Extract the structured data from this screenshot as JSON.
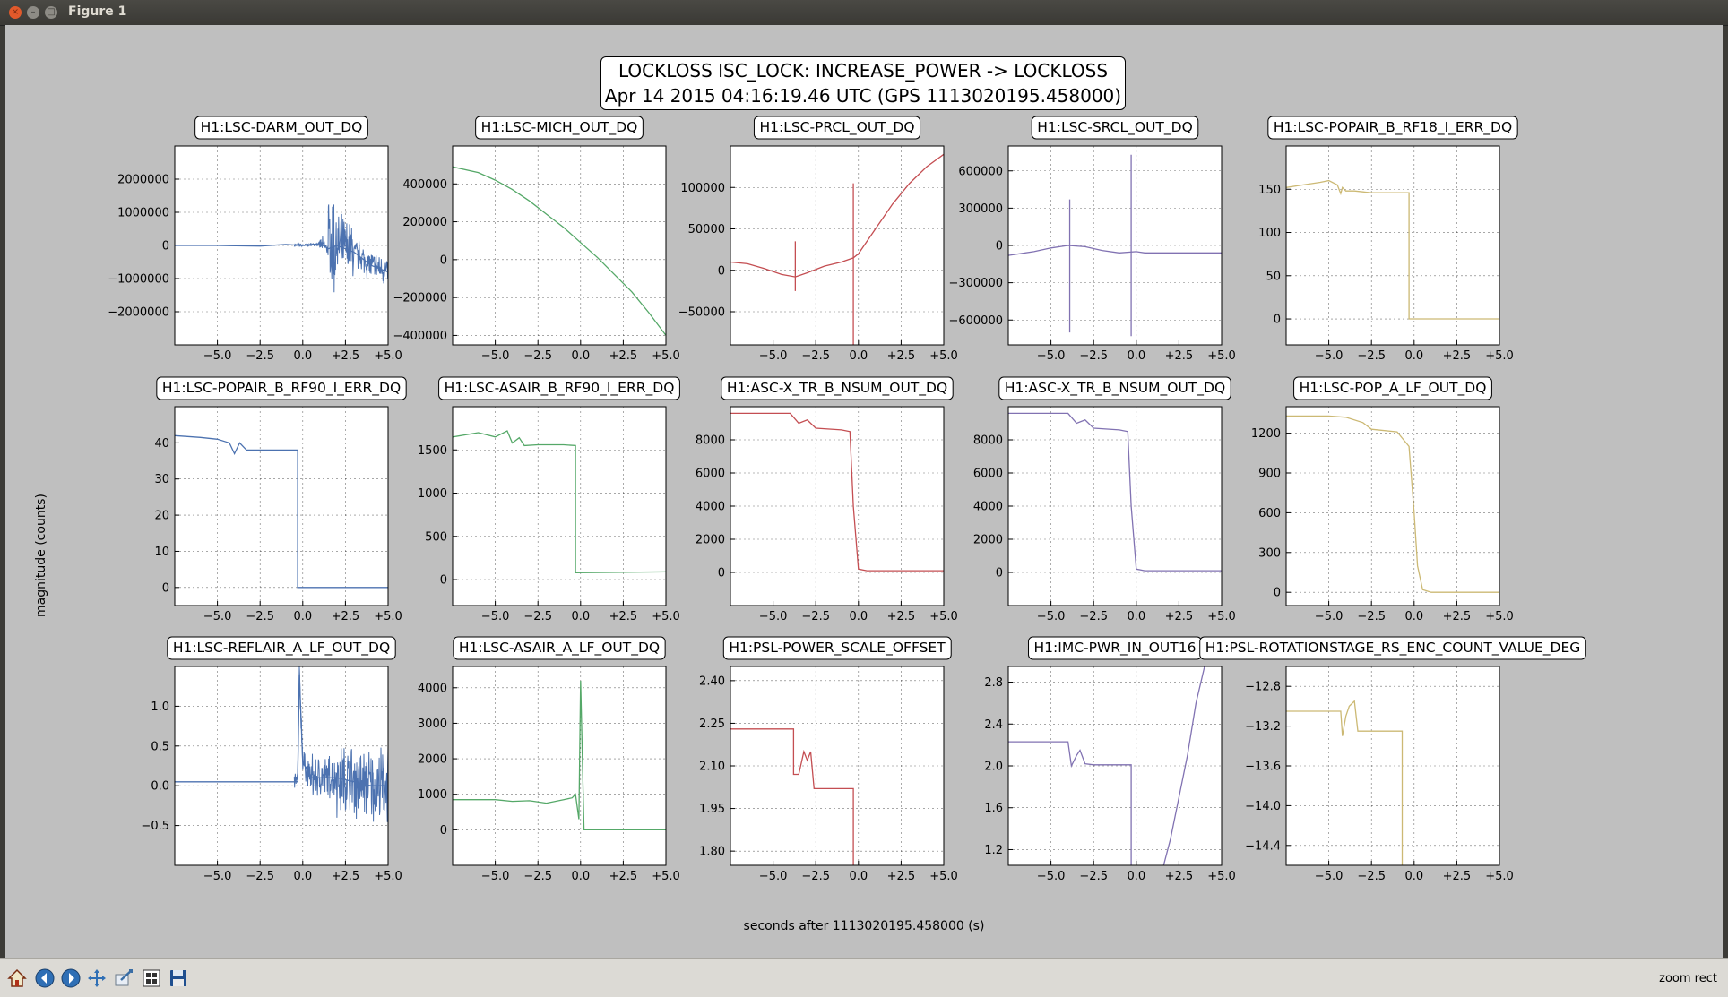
{
  "window": {
    "title": "Figure 1"
  },
  "figure": {
    "suptitle_line1": "LOCKLOSS ISC_LOCK: INCREASE_POWER -> LOCKLOSS",
    "suptitle_line2": "Apr 14 2015 04:16:19.46 UTC (GPS 1113020195.458000)",
    "ylabel": "magnitude (counts)",
    "xlabel": "seconds after 1113020195.458000 (s)"
  },
  "chart_data": [
    {
      "type": "line",
      "title": "H1:LSC-DARM_OUT_DQ",
      "color": "#4c72b0",
      "xlim": [
        -7.5,
        5
      ],
      "ylim": [
        -3000000,
        3000000
      ],
      "xticks": [
        -5,
        -2.5,
        0,
        2.5,
        5
      ],
      "xticklabels": [
        "−5.0",
        "−2.5",
        "0.0",
        "+2.5",
        "+5.0"
      ],
      "yticks": [
        -2000000,
        -1000000,
        0,
        1000000,
        2000000
      ],
      "yticklabels": [
        "−2000000",
        "−1000000",
        "0",
        "1000000",
        "2000000"
      ],
      "noise": [
        [
          1,
          40000
        ],
        [
          1.5,
          200000
        ],
        [
          2,
          1500000
        ],
        [
          3,
          800000
        ],
        [
          5,
          400000
        ]
      ],
      "series": [
        {
          "x": [
            -7.5,
            -5,
            -2.5,
            -1,
            0,
            1,
            1.5,
            2,
            3,
            4,
            5
          ],
          "y": [
            0,
            0,
            -20000,
            30000,
            0,
            50000,
            -100000,
            0,
            -200000,
            -600000,
            -800000
          ]
        }
      ]
    },
    {
      "type": "line",
      "title": "H1:LSC-MICH_OUT_DQ",
      "color": "#55a868",
      "xlim": [
        -7.5,
        5
      ],
      "ylim": [
        -450000,
        600000
      ],
      "xticks": [
        -5,
        -2.5,
        0,
        2.5,
        5
      ],
      "xticklabels": [
        "−5.0",
        "−2.5",
        "0.0",
        "+2.5",
        "+5.0"
      ],
      "yticks": [
        -400000,
        -200000,
        0,
        200000,
        400000
      ],
      "yticklabels": [
        "−400000",
        "−200000",
        "0",
        "200000",
        "400000"
      ],
      "series": [
        {
          "x": [
            -7.5,
            -6,
            -5,
            -4,
            -3,
            -2,
            -1,
            0,
            1,
            2,
            3,
            4,
            5
          ],
          "y": [
            490000,
            460000,
            420000,
            370000,
            310000,
            240000,
            170000,
            90000,
            10000,
            -80000,
            -170000,
            -280000,
            -400000
          ]
        }
      ]
    },
    {
      "type": "line",
      "title": "H1:LSC-PRCL_OUT_DQ",
      "color": "#c44e52",
      "xlim": [
        -7.5,
        5
      ],
      "ylim": [
        -90000,
        150000
      ],
      "xticks": [
        -5,
        -2.5,
        0,
        2.5,
        5
      ],
      "xticklabels": [
        "−5.0",
        "−2.5",
        "0.0",
        "+2.5",
        "+5.0"
      ],
      "yticks": [
        -50000,
        0,
        50000,
        100000
      ],
      "yticklabels": [
        "−50000",
        "0",
        "50000",
        "100000"
      ],
      "series": [
        {
          "x": [
            -7.5,
            -6.5,
            -5.5,
            -4.5,
            -3.7,
            -3,
            -2,
            -1,
            -0.3,
            0,
            1,
            2,
            3,
            4,
            5
          ],
          "y": [
            10000,
            8000,
            2000,
            -5000,
            -8000,
            -3000,
            5000,
            10000,
            15000,
            20000,
            50000,
            80000,
            105000,
            125000,
            140000
          ]
        }
      ],
      "spikes": [
        [
          -3.7,
          -25000,
          35000
        ],
        [
          -0.3,
          -90000,
          105000
        ]
      ]
    },
    {
      "type": "line",
      "title": "H1:LSC-SRCL_OUT_DQ",
      "color": "#8172b2",
      "xlim": [
        -7.5,
        5
      ],
      "ylim": [
        -800000,
        800000
      ],
      "xticks": [
        -5,
        -2.5,
        0,
        2.5,
        5
      ],
      "xticklabels": [
        "−5.0",
        "−2.5",
        "0.0",
        "+2.5",
        "+5.0"
      ],
      "yticks": [
        -600000,
        -300000,
        0,
        300000,
        600000
      ],
      "yticklabels": [
        "−600000",
        "−300000",
        "0",
        "300000",
        "600000"
      ],
      "series": [
        {
          "x": [
            -7.5,
            -6,
            -5,
            -4,
            -3,
            -2,
            -1,
            0,
            0.5,
            1,
            5
          ],
          "y": [
            -80000,
            -50000,
            -20000,
            0,
            -10000,
            -40000,
            -60000,
            -50000,
            -60000,
            -60000,
            -60000
          ]
        }
      ],
      "spikes": [
        [
          -3.9,
          -700000,
          370000
        ],
        [
          -0.3,
          -730000,
          730000
        ]
      ]
    },
    {
      "type": "line",
      "title": "H1:LSC-POPAIR_B_RF18_I_ERR_DQ",
      "color": "#ccb974",
      "xlim": [
        -7.5,
        5
      ],
      "ylim": [
        -30000,
        200000
      ],
      "yunit": 0.001,
      "xticks": [
        -5,
        -2.5,
        0,
        2.5,
        5
      ],
      "xticklabels": [
        "−5.0",
        "−2.5",
        "0.0",
        "+2.5",
        "+5.0"
      ],
      "yticks": [
        0,
        50000,
        100000,
        150000
      ],
      "yticklabels": [
        "0",
        "50",
        "100",
        "150"
      ],
      "series": [
        {
          "x": [
            -7.5,
            -6.5,
            -5.5,
            -5,
            -4.5,
            -4.3,
            -4.2,
            -4,
            -3.5,
            -3,
            -2.5,
            -1,
            -0.5,
            -0.3,
            -0.3,
            5
          ],
          "y": [
            152000,
            155000,
            158000,
            160000,
            155000,
            145000,
            152000,
            148000,
            148000,
            147000,
            146000,
            146000,
            146000,
            146000,
            0,
            0
          ]
        }
      ]
    },
    {
      "type": "line",
      "title": "H1:LSC-POPAIR_B_RF90_I_ERR_DQ",
      "color": "#4c72b0",
      "xlim": [
        -7.5,
        5
      ],
      "ylim": [
        -5,
        50
      ],
      "xticks": [
        -5,
        -2.5,
        0,
        2.5,
        5
      ],
      "xticklabels": [
        "−5.0",
        "−2.5",
        "0.0",
        "+2.5",
        "+5.0"
      ],
      "yticks": [
        0,
        10,
        20,
        30,
        40
      ],
      "yticklabels": [
        "0",
        "10",
        "20",
        "30",
        "40"
      ],
      "series": [
        {
          "x": [
            -7.5,
            -6,
            -5,
            -4.3,
            -4,
            -3.7,
            -3.3,
            -2.5,
            -1,
            -0.3,
            -0.3,
            5
          ],
          "y": [
            42,
            41.5,
            41,
            40,
            37,
            40,
            38,
            38,
            38,
            38,
            0,
            0
          ]
        }
      ]
    },
    {
      "type": "line",
      "title": "H1:LSC-ASAIR_B_RF90_I_ERR_DQ",
      "color": "#55a868",
      "xlim": [
        -7.5,
        5
      ],
      "ylim": [
        -300,
        2000
      ],
      "xticks": [
        -5,
        -2.5,
        0,
        2.5,
        5
      ],
      "xticklabels": [
        "−5.0",
        "−2.5",
        "0.0",
        "+2.5",
        "+5.0"
      ],
      "yticks": [
        0,
        500,
        1000,
        1500
      ],
      "yticklabels": [
        "0",
        "500",
        "1000",
        "1500"
      ],
      "series": [
        {
          "x": [
            -7.5,
            -6,
            -5,
            -4.3,
            -4,
            -3.6,
            -3.3,
            -2.5,
            -1,
            -0.3,
            -0.3,
            5
          ],
          "y": [
            1650,
            1700,
            1650,
            1720,
            1580,
            1640,
            1550,
            1560,
            1560,
            1550,
            80,
            90
          ]
        }
      ]
    },
    {
      "type": "line",
      "title": "H1:ASC-X_TR_B_NSUM_OUT_DQ",
      "color": "#c44e52",
      "xlim": [
        -7.5,
        5
      ],
      "ylim": [
        -2000,
        10000
      ],
      "xticks": [
        -5,
        -2.5,
        0,
        2.5,
        5
      ],
      "xticklabels": [
        "−5.0",
        "−2.5",
        "0.0",
        "+2.5",
        "+5.0"
      ],
      "yticks": [
        0,
        2000,
        4000,
        6000,
        8000
      ],
      "yticklabels": [
        "0",
        "2000",
        "4000",
        "6000",
        "8000"
      ],
      "series": [
        {
          "x": [
            -7.5,
            -5,
            -4,
            -3.5,
            -3,
            -2.5,
            -1,
            -0.5,
            -0.3,
            0,
            0.5,
            5
          ],
          "y": [
            9600,
            9600,
            9600,
            9000,
            9200,
            8700,
            8600,
            8500,
            4000,
            200,
            100,
            100
          ]
        }
      ]
    },
    {
      "type": "line",
      "title": "H1:ASC-X_TR_B_NSUM_OUT_DQ",
      "color": "#8172b2",
      "xlim": [
        -7.5,
        5
      ],
      "ylim": [
        -2000,
        10000
      ],
      "xticks": [
        -5,
        -2.5,
        0,
        2.5,
        5
      ],
      "xticklabels": [
        "−5.0",
        "−2.5",
        "0.0",
        "+2.5",
        "+5.0"
      ],
      "yticks": [
        0,
        2000,
        4000,
        6000,
        8000
      ],
      "yticklabels": [
        "0",
        "2000",
        "4000",
        "6000",
        "8000"
      ],
      "series": [
        {
          "x": [
            -7.5,
            -5,
            -4,
            -3.5,
            -3,
            -2.5,
            -1,
            -0.5,
            -0.3,
            0,
            0.5,
            5
          ],
          "y": [
            9600,
            9600,
            9600,
            9000,
            9200,
            8700,
            8600,
            8500,
            4000,
            200,
            100,
            100
          ]
        }
      ]
    },
    {
      "type": "line",
      "title": "H1:LSC-POP_A_LF_OUT_DQ",
      "color": "#ccb974",
      "xlim": [
        -7.5,
        5
      ],
      "ylim": [
        -100,
        1400
      ],
      "xticks": [
        -5,
        -2.5,
        0,
        2.5,
        5
      ],
      "xticklabels": [
        "−5.0",
        "−2.5",
        "0.0",
        "+2.5",
        "+5.0"
      ],
      "yticks": [
        0,
        300,
        600,
        900,
        1200
      ],
      "yticklabels": [
        "0",
        "300",
        "600",
        "900",
        "1200"
      ],
      "series": [
        {
          "x": [
            -7.5,
            -5,
            -4,
            -3,
            -2.5,
            -1,
            -0.3,
            0,
            0.2,
            0.5,
            1,
            5
          ],
          "y": [
            1330,
            1330,
            1320,
            1280,
            1230,
            1210,
            1100,
            600,
            200,
            20,
            0,
            0
          ]
        }
      ]
    },
    {
      "type": "line",
      "title": "H1:LSC-REFLAIR_A_LF_OUT_DQ",
      "color": "#4c72b0",
      "xlim": [
        -7.5,
        5
      ],
      "ylim": [
        -1,
        1.5
      ],
      "xticks": [
        -5,
        -2.5,
        0,
        2.5,
        5
      ],
      "xticklabels": [
        "−5.0",
        "−2.5",
        "0.0",
        "+2.5",
        "+5.0"
      ],
      "yticks": [
        -0.5,
        0,
        0.5,
        1
      ],
      "yticklabels": [
        "−0.5",
        "0.0",
        "0.5",
        "1.0"
      ],
      "noise": [
        [
          0.5,
          0.15
        ],
        [
          2,
          0.25
        ],
        [
          5,
          0.4
        ]
      ],
      "series": [
        {
          "x": [
            -7.5,
            -5,
            -2.5,
            -0.3,
            -0.2,
            0,
            0.5,
            1,
            2,
            3,
            4,
            5
          ],
          "y": [
            0.05,
            0.05,
            0.05,
            0.05,
            1.4,
            0.3,
            0.1,
            0.1,
            0.1,
            0.05,
            0,
            0
          ]
        }
      ]
    },
    {
      "type": "line",
      "title": "H1:LSC-ASAIR_A_LF_OUT_DQ",
      "color": "#55a868",
      "xlim": [
        -7.5,
        5
      ],
      "ylim": [
        -1000,
        4600
      ],
      "xticks": [
        -5,
        -2.5,
        0,
        2.5,
        5
      ],
      "xticklabels": [
        "−5.0",
        "−2.5",
        "0.0",
        "+2.5",
        "+5.0"
      ],
      "yticks": [
        0,
        1000,
        2000,
        3000,
        4000
      ],
      "yticklabels": [
        "0",
        "1000",
        "2000",
        "3000",
        "4000"
      ],
      "series": [
        {
          "x": [
            -7.5,
            -5,
            -4,
            -3,
            -2,
            -1,
            -0.5,
            -0.3,
            -0.1,
            0,
            0.2,
            5
          ],
          "y": [
            850,
            850,
            800,
            820,
            750,
            850,
            900,
            1000,
            300,
            4200,
            0,
            0
          ]
        }
      ]
    },
    {
      "type": "line",
      "title": "H1:PSL-POWER_SCALE_OFFSET",
      "color": "#c44e52",
      "xlim": [
        -7.5,
        5
      ],
      "ylim": [
        1.75,
        2.45
      ],
      "xticks": [
        -5,
        -2.5,
        0,
        2.5,
        5
      ],
      "xticklabels": [
        "−5.0",
        "−2.5",
        "0.0",
        "+2.5",
        "+5.0"
      ],
      "yticks": [
        1.8,
        1.95,
        2.1,
        2.25,
        2.4
      ],
      "yticklabels": [
        "1.80",
        "1.95",
        "2.10",
        "2.25",
        "2.40"
      ],
      "series": [
        {
          "x": [
            -7.5,
            -3.8,
            -3.8,
            -3.5,
            -3.2,
            -3,
            -2.8,
            -2.6,
            -2.6,
            -0.3,
            -0.3
          ],
          "y": [
            2.23,
            2.23,
            2.07,
            2.07,
            2.15,
            2.12,
            2.15,
            2.02,
            2.02,
            2.02,
            1.75
          ]
        }
      ]
    },
    {
      "type": "line",
      "title": "H1:IMC-PWR_IN_OUT16",
      "color": "#8172b2",
      "xlim": [
        -7.5,
        5
      ],
      "ylim": [
        1.05,
        2.95
      ],
      "xticks": [
        -5,
        -2.5,
        0,
        2.5,
        5
      ],
      "xticklabels": [
        "−5.0",
        "−2.5",
        "0.0",
        "+2.5",
        "+5.0"
      ],
      "yticks": [
        1.2,
        1.6,
        2.0,
        2.4,
        2.8
      ],
      "yticklabels": [
        "1.2",
        "1.6",
        "2.0",
        "2.4",
        "2.8"
      ],
      "series": [
        {
          "x": [
            -7.5,
            -4,
            -3.8,
            -3.5,
            -3.3,
            -3,
            -2.5,
            -0.3,
            -0.3
          ],
          "y": [
            2.23,
            2.23,
            2.0,
            2.1,
            2.15,
            2.02,
            2.01,
            2.01,
            1.05
          ]
        },
        {
          "x": [
            1.6,
            2,
            2.5,
            3,
            3.5,
            4
          ],
          "y": [
            1.05,
            1.3,
            1.7,
            2.1,
            2.6,
            2.95
          ]
        }
      ]
    },
    {
      "type": "line",
      "title": "H1:PSL-ROTATIONSTAGE_RS_ENC_COUNT_VALUE_DEG",
      "color": "#ccb974",
      "xlim": [
        -7.5,
        5
      ],
      "ylim": [
        -14.6,
        -12.6
      ],
      "xticks": [
        -5,
        -2.5,
        0,
        2.5,
        5
      ],
      "xticklabels": [
        "−5.0",
        "−2.5",
        "0.0",
        "+2.5",
        "+5.0"
      ],
      "yticks": [
        -14.4,
        -14,
        -13.6,
        -13.2,
        -12.8
      ],
      "yticklabels": [
        "−14.4",
        "−14.0",
        "−13.6",
        "−13.2",
        "−12.8"
      ],
      "series": [
        {
          "x": [
            -7.5,
            -4.3,
            -4.2,
            -4,
            -3.8,
            -3.5,
            -3.3,
            -3.2,
            -2.5,
            -0.7,
            -0.7
          ],
          "y": [
            -13.05,
            -13.05,
            -13.3,
            -13.1,
            -13.0,
            -12.95,
            -13.25,
            -13.25,
            -13.25,
            -13.25,
            -14.6
          ]
        }
      ]
    }
  ],
  "toolbar": {
    "icons": [
      "home-icon",
      "back-icon",
      "forward-icon",
      "pan-icon",
      "zoom-icon",
      "subplots-icon",
      "save-icon"
    ],
    "status": "zoom rect"
  }
}
